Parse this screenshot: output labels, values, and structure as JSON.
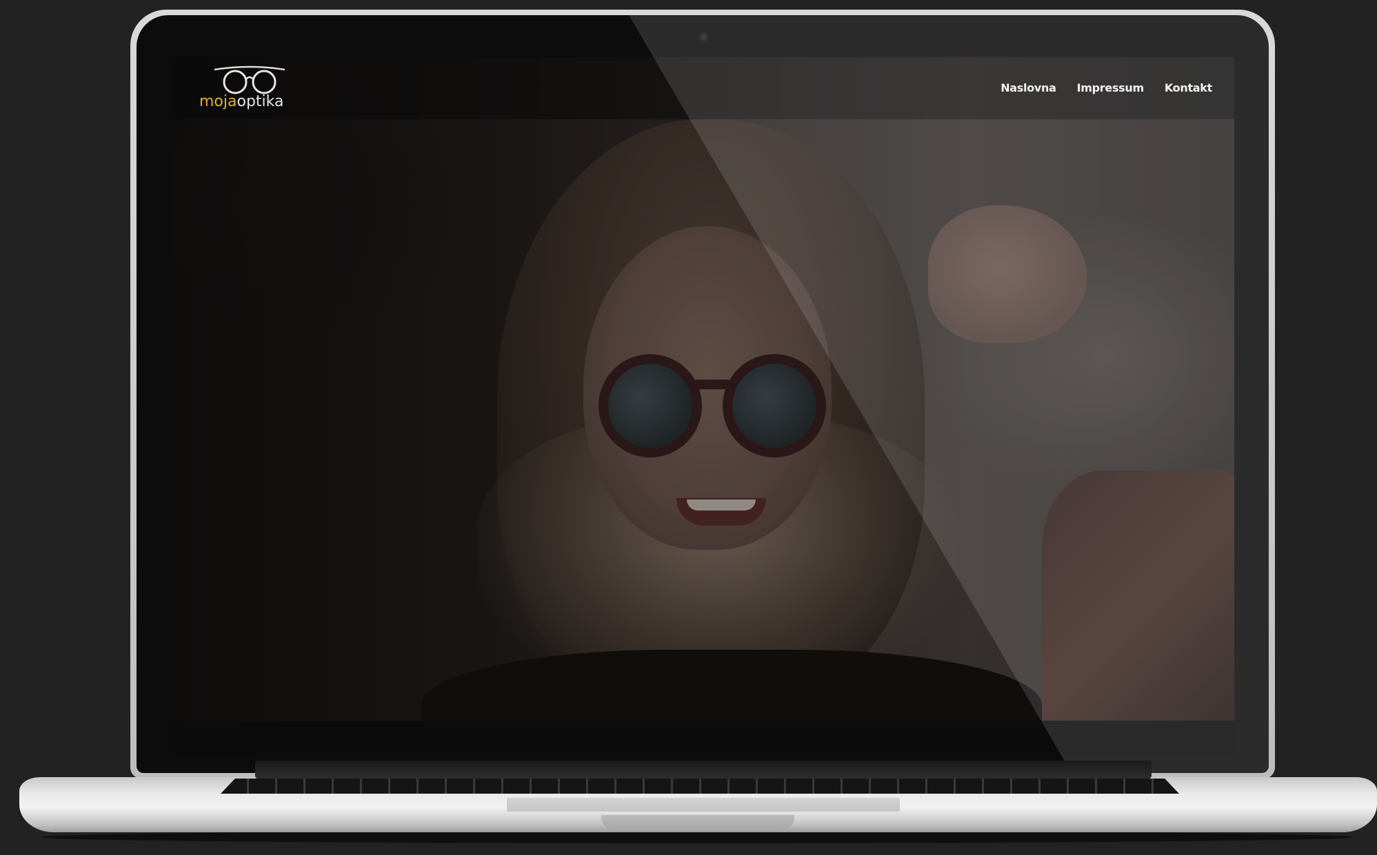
{
  "site": {
    "logo": {
      "part1": "moja",
      "part2": "optika",
      "icon": "glasses-icon",
      "accent_color": "#e0b22a",
      "text_color": "#e4e4e4"
    },
    "nav": {
      "items": [
        {
          "label": "Naslovna"
        },
        {
          "label": "Impressum"
        },
        {
          "label": "Kontakt"
        }
      ]
    },
    "hero": {
      "image": "woman-with-round-sunglasses"
    }
  },
  "colors": {
    "background": "#222222",
    "nav_text": "#f2f2f2"
  }
}
